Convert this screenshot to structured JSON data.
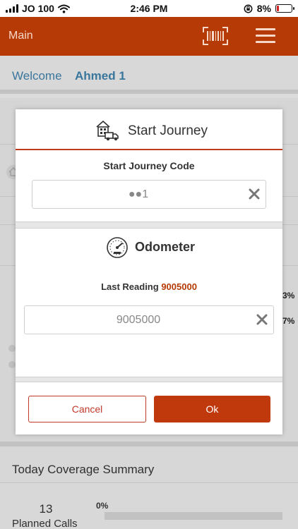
{
  "status_bar": {
    "carrier": "JO 100",
    "time": "2:46 PM",
    "battery": "8%"
  },
  "header": {
    "title": "Main"
  },
  "background": {
    "welcome_label": "Welcome",
    "user_name": "Ahmed 1",
    "pct_a": "3%",
    "pct_b": "7%",
    "coverage_title": "Today Coverage Summary",
    "planned_calls_count": "13",
    "planned_calls_label": "Planned Calls",
    "planned_calls_pct": "0%"
  },
  "dialog": {
    "title": "Start Journey",
    "code_label": "Start Journey Code",
    "code_value": "●●1",
    "odometer_title": "Odometer",
    "last_reading_label": "Last Reading",
    "last_reading_value": "9005000",
    "odometer_value": "9005000",
    "cancel_label": "Cancel",
    "ok_label": "Ok"
  },
  "colors": {
    "brand": "#b53a06",
    "accent_text": "#3d7ea6",
    "ok_button": "#c0390d"
  },
  "icons": [
    "signal-icon",
    "wifi-icon",
    "lock-rotation-icon",
    "battery-icon",
    "barcode-scan-icon",
    "menu-icon",
    "truck-building-icon",
    "clear-icon",
    "speedometer-icon",
    "home-icon"
  ]
}
